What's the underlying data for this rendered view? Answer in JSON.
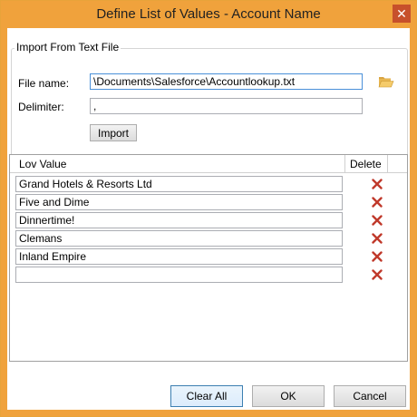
{
  "window": {
    "title": "Define List of Values - Account Name",
    "close_glyph": "✕"
  },
  "import_group": {
    "title": "Import From Text File",
    "file_name_label": "File name:",
    "file_name_value": "\\Documents\\Salesforce\\Accountlookup.txt",
    "delimiter_label": "Delimiter:",
    "delimiter_value": ",",
    "import_button": "Import",
    "browse_icon": "folder-open-icon"
  },
  "grid": {
    "columns": [
      "Lov Value",
      "Delete"
    ],
    "rows": [
      {
        "value": "Grand Hotels & Resorts Ltd"
      },
      {
        "value": "Five and Dime"
      },
      {
        "value": "Dinnertime!"
      },
      {
        "value": "Clemans"
      },
      {
        "value": "Inland Empire"
      },
      {
        "value": ""
      }
    ],
    "delete_icon": "delete-x-icon",
    "delete_color": "#c0392b"
  },
  "footer": {
    "clear_all_button": "Clear All",
    "ok_button": "OK",
    "cancel_button": "Cancel"
  },
  "colors": {
    "title_bar": "#f0a23c",
    "primary_border": "#3c7fb1"
  }
}
